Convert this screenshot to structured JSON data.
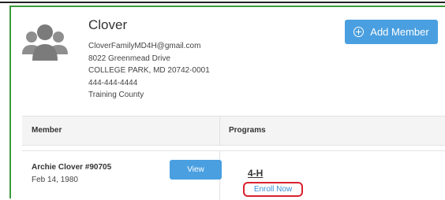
{
  "family": {
    "name": "Clover",
    "email": "CloverFamilyMD4H@gmail.com",
    "address1": "8022 Greenmead Drive",
    "address2": "COLLEGE PARK, MD 20742-0001",
    "phone": "444-444-4444",
    "county": "Training County"
  },
  "actions": {
    "add_member_label": "Add Member",
    "add_icon": "plus-circle-icon",
    "accent_color": "#4a9fe0"
  },
  "table": {
    "headers": {
      "member": "Member",
      "programs": "Programs"
    },
    "rows": [
      {
        "member_name": "Archie Clover #90705",
        "dob": "Feb 14, 1980",
        "view_label": "View",
        "program": "4-H",
        "enroll_label": "Enroll Now"
      }
    ]
  }
}
